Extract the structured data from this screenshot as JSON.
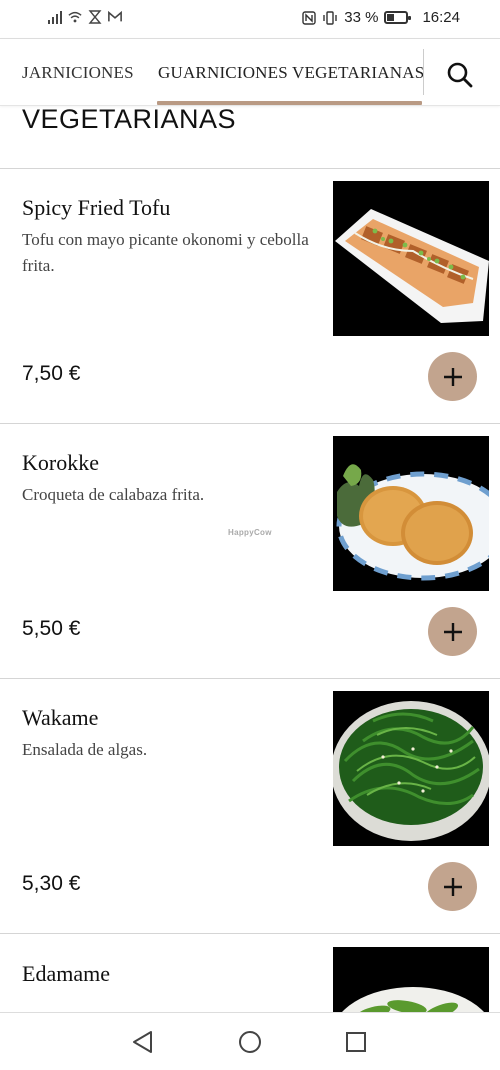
{
  "status": {
    "battery_text": "33 %",
    "battery_level": 0.33,
    "time": "16:24"
  },
  "tabs": [
    {
      "label": "JARNICIONES",
      "active": false
    },
    {
      "label": "GUARNICIONES VEGETARIANAS",
      "active": true
    }
  ],
  "section": {
    "title": "VEGETARIANAS"
  },
  "items": [
    {
      "name": "Spicy Fried Tofu",
      "description": "Tofu con mayo picante okonomi y cebolla frita.",
      "price": "7,50 €",
      "image": "fried-tofu-photo"
    },
    {
      "name": "Korokke",
      "description": "Croqueta de calabaza frita.",
      "price": "5,50 €",
      "image": "korokke-photo",
      "watermark": "HappyCow"
    },
    {
      "name": "Wakame",
      "description": "Ensalada de algas.",
      "price": "5,30 €",
      "image": "wakame-photo"
    },
    {
      "name": "Edamame",
      "description": "",
      "price": "",
      "image": "edamame-photo"
    }
  ],
  "colors": {
    "accent": "#c2a48e",
    "tab_underline": "#b99a84"
  },
  "icons": {
    "search": "search-icon",
    "add": "plus-icon",
    "nav_back": "back-triangle-icon",
    "nav_home": "home-circle-icon",
    "nav_recent": "recent-square-icon"
  }
}
